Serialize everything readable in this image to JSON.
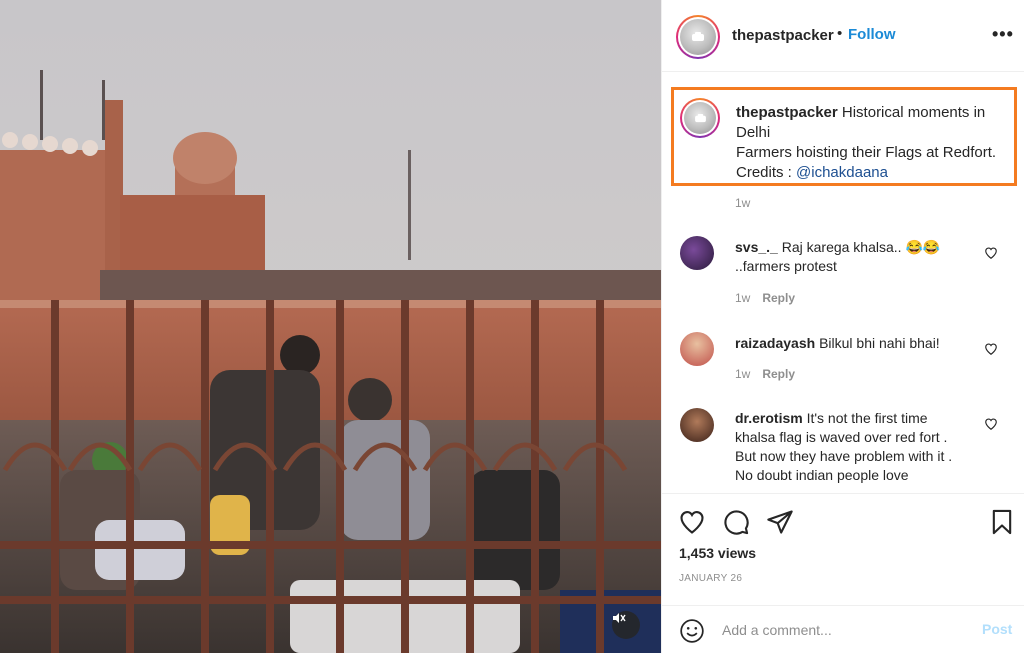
{
  "post": {
    "author": "thepastpacker",
    "follow_label": "Follow",
    "dot_separator": "•",
    "more_label": "•••"
  },
  "caption": {
    "username": "thepastpacker",
    "line1": "Historical moments in Delhi",
    "line2": "Farmers hoisting their Flags at Redfort.",
    "credits_prefix": "Credits : ",
    "mention": "@ichakdaana",
    "time": "1w",
    "highlight_color": "#f47b20"
  },
  "comments": [
    {
      "username": "svs_._",
      "text": "Raj karega khalsa.. 😂😂 ..farmers protest",
      "time": "1w",
      "reply_label": "Reply"
    },
    {
      "username": "raizadayash",
      "text": "Bilkul bhi nahi bhai!",
      "time": "1w",
      "reply_label": "Reply"
    },
    {
      "username": "dr.erotism",
      "text": "It's not the first time khalsa flag is waved over red fort . But now they have problem with it . No doubt indian people love"
    }
  ],
  "stats": {
    "views": "1,453 views",
    "date": "JANUARY 26"
  },
  "composer": {
    "placeholder": "Add a comment...",
    "post_label": "Post"
  },
  "colors": {
    "follow": "#1b8ad6",
    "mention": "#1d4f91",
    "post_disabled": "#b2dffc"
  },
  "icons": {
    "like": "heart-icon",
    "comment": "comment-icon",
    "share": "paper-plane-icon",
    "save": "bookmark-icon",
    "emoji": "smiley-icon",
    "mute": "speaker-muted-icon"
  }
}
